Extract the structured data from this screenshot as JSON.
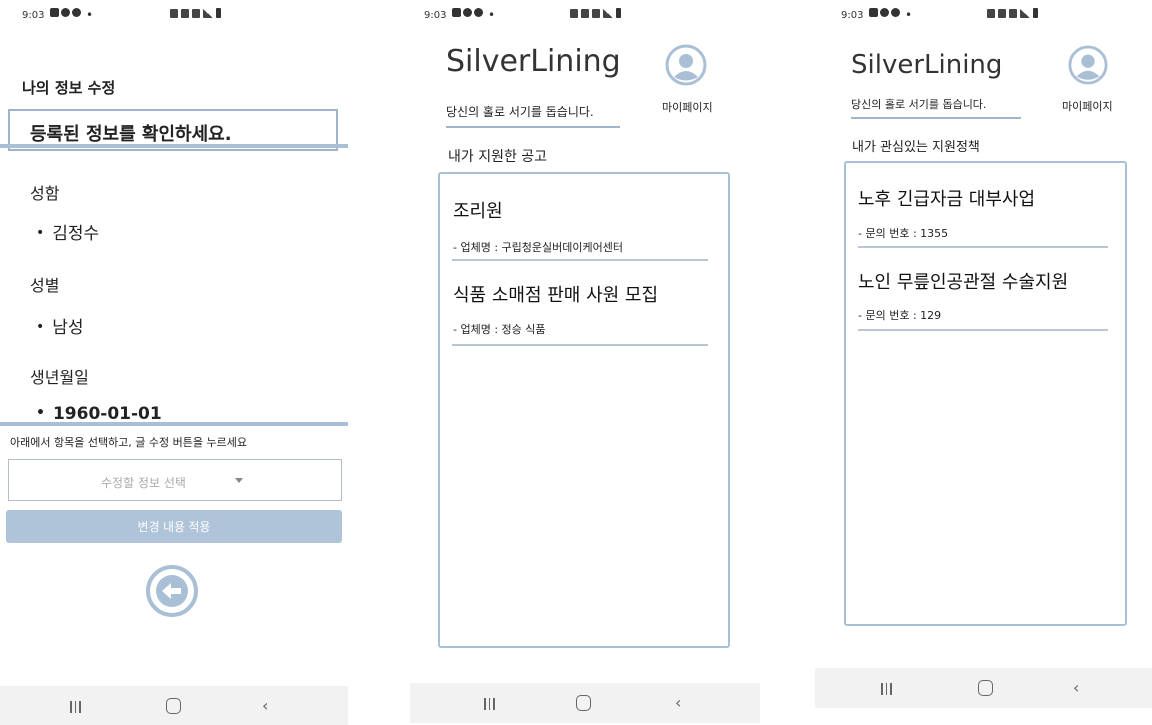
{
  "status_bar": {
    "time": "9:03",
    "dot": "•"
  },
  "screen1": {
    "title": "나의 정보 수정",
    "confirm_banner": "등록된 정보를 확인하세요.",
    "fields": [
      {
        "label": "성함",
        "value": "김정수"
      },
      {
        "label": "성별",
        "value": "남성"
      },
      {
        "label": "생년월일",
        "value": "1960-01-01"
      }
    ],
    "instruction": "아래에서 항목을 선택하고, 글 수정 버튼을 누르세요",
    "select_placeholder": "수정할 정보 선택",
    "apply_button": "변경 내용 적용",
    "back_icon": "arrow-left-circle-icon"
  },
  "screen2": {
    "brand": "SilverLining",
    "tagline": "당신의 홀로 서기를 돕습니다.",
    "mypage_label": "마이페이지",
    "section_title": "내가 지원한 공고",
    "items": [
      {
        "title": "조리원",
        "sub": "- 업체명 : 구립청운실버데이케어센터"
      },
      {
        "title": "식품 소매점 판매 사원 모집",
        "sub": "- 업체명 : 정승 식품"
      }
    ]
  },
  "screen3": {
    "brand": "SilverLining",
    "tagline": "당신의 홀로 서기를 돕습니다.",
    "mypage_label": "마이페이지",
    "section_title": "내가 관심있는 지원정책",
    "items": [
      {
        "title": "노후 긴급자금 대부사업",
        "sub": "- 문의 번호 : 1355"
      },
      {
        "title": "노인 무릎인공관절 수술지원",
        "sub": "- 문의 번호 : 129"
      }
    ]
  },
  "colors": {
    "accent": "#a9bfd6",
    "button": "#afc3d9",
    "navbar": "#f2f2f2"
  }
}
